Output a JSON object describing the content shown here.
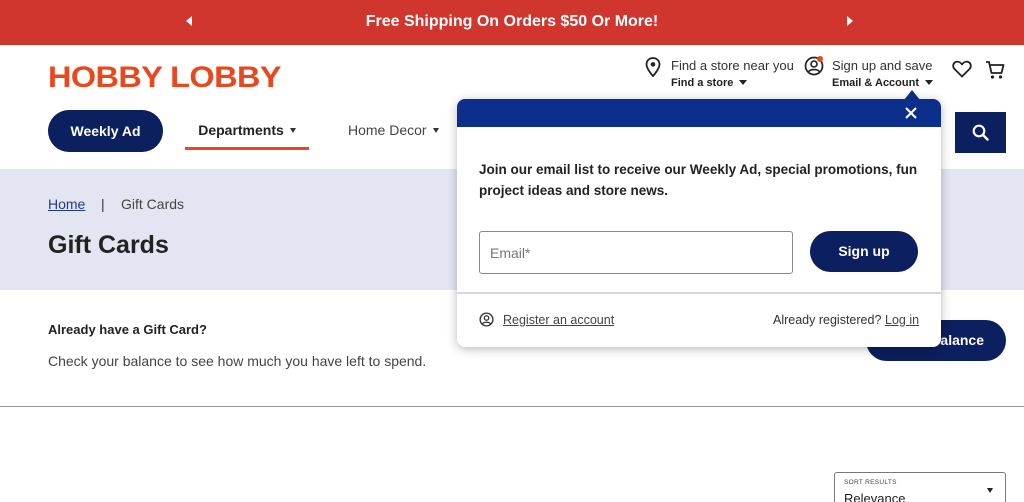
{
  "promo": {
    "text": "Free Shipping On Orders $50 Or More!",
    "prev_icon": "chevron-left-icon",
    "next_icon": "chevron-right-icon"
  },
  "header": {
    "logo": "HOBBY LOBBY",
    "store": {
      "title": "Find a store near you",
      "sub": "Find a store",
      "icon": "map-pin-icon"
    },
    "account": {
      "title": "Sign up and save",
      "sub": "Email & Account",
      "icon": "user-circle-icon"
    },
    "wishlist_icon": "heart-icon",
    "cart_icon": "cart-icon"
  },
  "nav": {
    "weekly_ad": "Weekly Ad",
    "departments": "Departments",
    "home_decor": "Home Decor",
    "search_icon": "search-icon"
  },
  "breadcrumb": {
    "home": "Home",
    "separator": "|",
    "current": "Gift Cards"
  },
  "page": {
    "title": "Gift Cards"
  },
  "gift_card": {
    "heading": "Already have a Gift Card?",
    "text": "Check your balance to see how much you have left to spend.",
    "button": "balance"
  },
  "sort": {
    "label": "SORT RESULTS",
    "value": "Relevance"
  },
  "popup": {
    "message": "Join our email list to receive our Weekly Ad, special promotions, fun project ideas and store news.",
    "email_placeholder": "Email*",
    "signup": "Sign up",
    "register": "Register an account",
    "already": "Already registered?",
    "login": "Log in",
    "close_icon": "close-icon"
  },
  "colors": {
    "promo_bg": "#d0352e",
    "brand_orange": "#e8481c",
    "navy": "#0c1f5e",
    "popup_header": "#0c2f8c",
    "hero_bg": "#e3e6f2"
  }
}
